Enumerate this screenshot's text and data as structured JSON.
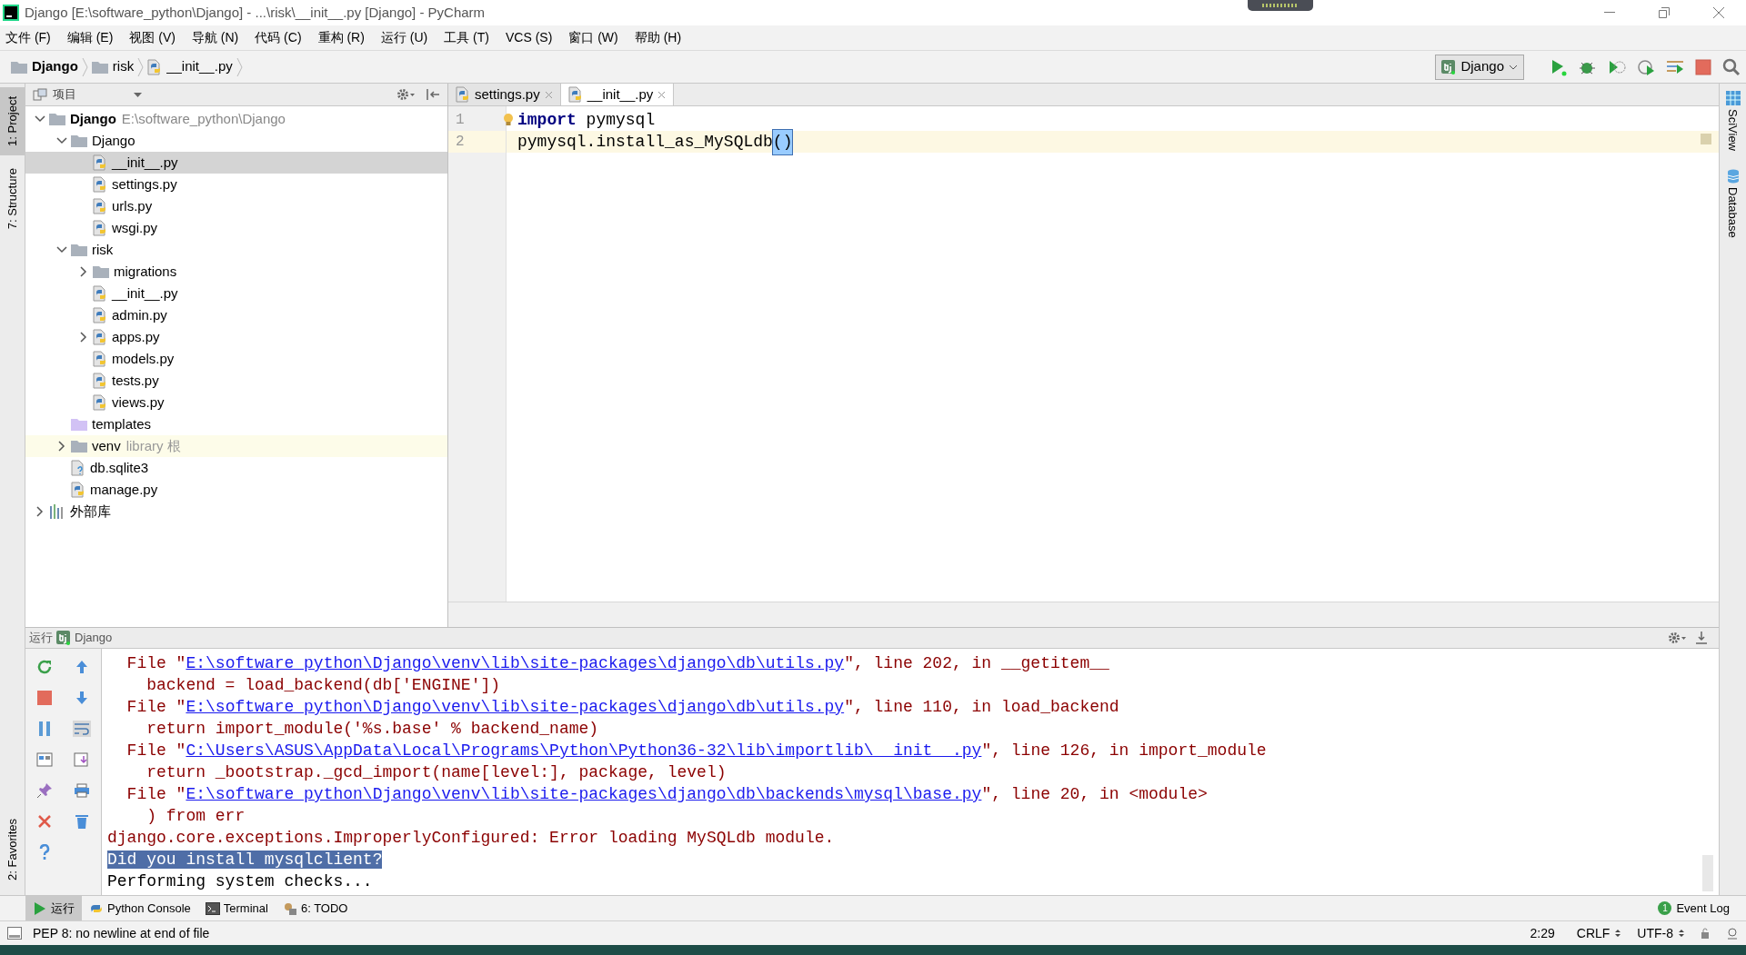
{
  "window": {
    "title": "Django [E:\\software_python\\Django] - ...\\risk\\__init__.py [Django] - PyCharm"
  },
  "menu": [
    "文件 (F)",
    "编辑 (E)",
    "视图 (V)",
    "导航 (N)",
    "代码 (C)",
    "重构 (R)",
    "运行 (U)",
    "工具 (T)",
    "VCS (S)",
    "窗口 (W)",
    "帮助 (H)"
  ],
  "breadcrumb": [
    {
      "label": "Django",
      "kind": "project"
    },
    {
      "label": "risk",
      "kind": "folder"
    },
    {
      "label": "__init__.py",
      "kind": "py"
    }
  ],
  "run_config": {
    "label": "Django"
  },
  "left_tools": [
    {
      "label": "1: Project",
      "selected": true,
      "kind": "top"
    },
    {
      "label": "7: Structure",
      "selected": false,
      "kind": "top"
    },
    {
      "label": "2: Favorites",
      "selected": false,
      "kind": "bottom"
    }
  ],
  "right_tools": [
    {
      "label": "SciView",
      "kind": "grid"
    },
    {
      "label": "Database",
      "kind": "db"
    }
  ],
  "project": {
    "title": "项目",
    "tree": [
      {
        "label": "Django",
        "kind": "project",
        "path": "E:\\software_python\\Django",
        "expanded": true,
        "selected": false,
        "children": [
          {
            "label": "Django",
            "kind": "folder",
            "expanded": true,
            "selected": false,
            "children": [
              {
                "label": "__init__.py",
                "kind": "py",
                "selected": true
              },
              {
                "label": "settings.py",
                "kind": "py",
                "selected": false
              },
              {
                "label": "urls.py",
                "kind": "py",
                "selected": false
              },
              {
                "label": "wsgi.py",
                "kind": "py",
                "selected": false
              }
            ]
          },
          {
            "label": "risk",
            "kind": "folder",
            "expanded": true,
            "selected": false,
            "children": [
              {
                "label": "migrations",
                "kind": "folder",
                "expanded": false,
                "selected": false
              },
              {
                "label": "__init__.py",
                "kind": "py",
                "selected": false
              },
              {
                "label": "admin.py",
                "kind": "py",
                "selected": false
              },
              {
                "label": "apps.py",
                "kind": "py",
                "expanded": false,
                "selected": false
              },
              {
                "label": "models.py",
                "kind": "py",
                "selected": false
              },
              {
                "label": "tests.py",
                "kind": "py",
                "selected": false
              },
              {
                "label": "views.py",
                "kind": "py",
                "selected": false
              }
            ]
          },
          {
            "label": "templates",
            "kind": "templates",
            "selected": false
          },
          {
            "label": "venv",
            "kind": "library",
            "hint": "library 根",
            "expanded": false,
            "selected": false
          },
          {
            "label": "db.sqlite3",
            "kind": "db",
            "selected": false
          },
          {
            "label": "manage.py",
            "kind": "py",
            "selected": false
          }
        ]
      },
      {
        "label": "外部库",
        "kind": "libraries",
        "expanded": false,
        "selected": false
      }
    ]
  },
  "editor": {
    "tabs": [
      {
        "label": "settings.py",
        "selected": false
      },
      {
        "label": "__init__.py",
        "selected": true
      }
    ],
    "lines": [
      {
        "number": "1",
        "current": false,
        "tokens": [
          {
            "text": "import",
            "kind": "keyword"
          },
          {
            "text": " pymysql",
            "kind": "plain"
          }
        ]
      },
      {
        "number": "2",
        "current": true,
        "tokens": [
          {
            "text": "pymysql.install_as_MySQLdb",
            "kind": "plain"
          },
          {
            "text": "()",
            "kind": "brace-match"
          }
        ]
      }
    ]
  },
  "run": {
    "title": "运行",
    "config": "Django",
    "lines": [
      {
        "kind": "file",
        "prefix": "  File \"",
        "link": "E:\\software_python\\Django\\venv\\lib\\site-packages\\django\\db\\utils.py",
        "suffix": "\", line 202, in __getitem__"
      },
      {
        "kind": "error",
        "text": "    backend = load_backend(db['ENGINE'])"
      },
      {
        "kind": "file",
        "prefix": "  File \"",
        "link": "E:\\software_python\\Django\\venv\\lib\\site-packages\\django\\db\\utils.py",
        "suffix": "\", line 110, in load_backend"
      },
      {
        "kind": "error",
        "text": "    return import_module('%s.base' % backend_name)"
      },
      {
        "kind": "file",
        "prefix": "  File \"",
        "link": "C:\\Users\\ASUS\\AppData\\Local\\Programs\\Python\\Python36-32\\lib\\importlib\\__init__.py",
        "suffix": "\", line 126, in import_module"
      },
      {
        "kind": "error",
        "text": "    return _bootstrap._gcd_import(name[level:], package, level)"
      },
      {
        "kind": "file",
        "prefix": "  File \"",
        "link": "E:\\software_python\\Django\\venv\\lib\\site-packages\\django\\db\\backends\\mysql\\base.py",
        "suffix": "\", line 20, in <module>"
      },
      {
        "kind": "error",
        "text": "    ) from err"
      },
      {
        "kind": "error",
        "text": "django.core.exceptions.ImproperlyConfigured: Error loading MySQLdb module."
      },
      {
        "kind": "selected",
        "text": "Did you install mysqlclient?"
      },
      {
        "kind": "output",
        "text": "Performing system checks..."
      }
    ]
  },
  "bottom_tools": [
    {
      "label": "运行",
      "kind": "run",
      "selected": true
    },
    {
      "label": "Python Console",
      "kind": "python",
      "selected": false
    },
    {
      "label": "Terminal",
      "kind": "terminal",
      "selected": false
    },
    {
      "label": "6: TODO",
      "kind": "todo",
      "selected": false
    }
  ],
  "event_log": {
    "label": "Event Log",
    "count": "1"
  },
  "status_bar": {
    "message": "PEP 8: no newline at end of file",
    "position": "2:29",
    "line_separator": "CRLF",
    "encoding": "UTF-8"
  }
}
